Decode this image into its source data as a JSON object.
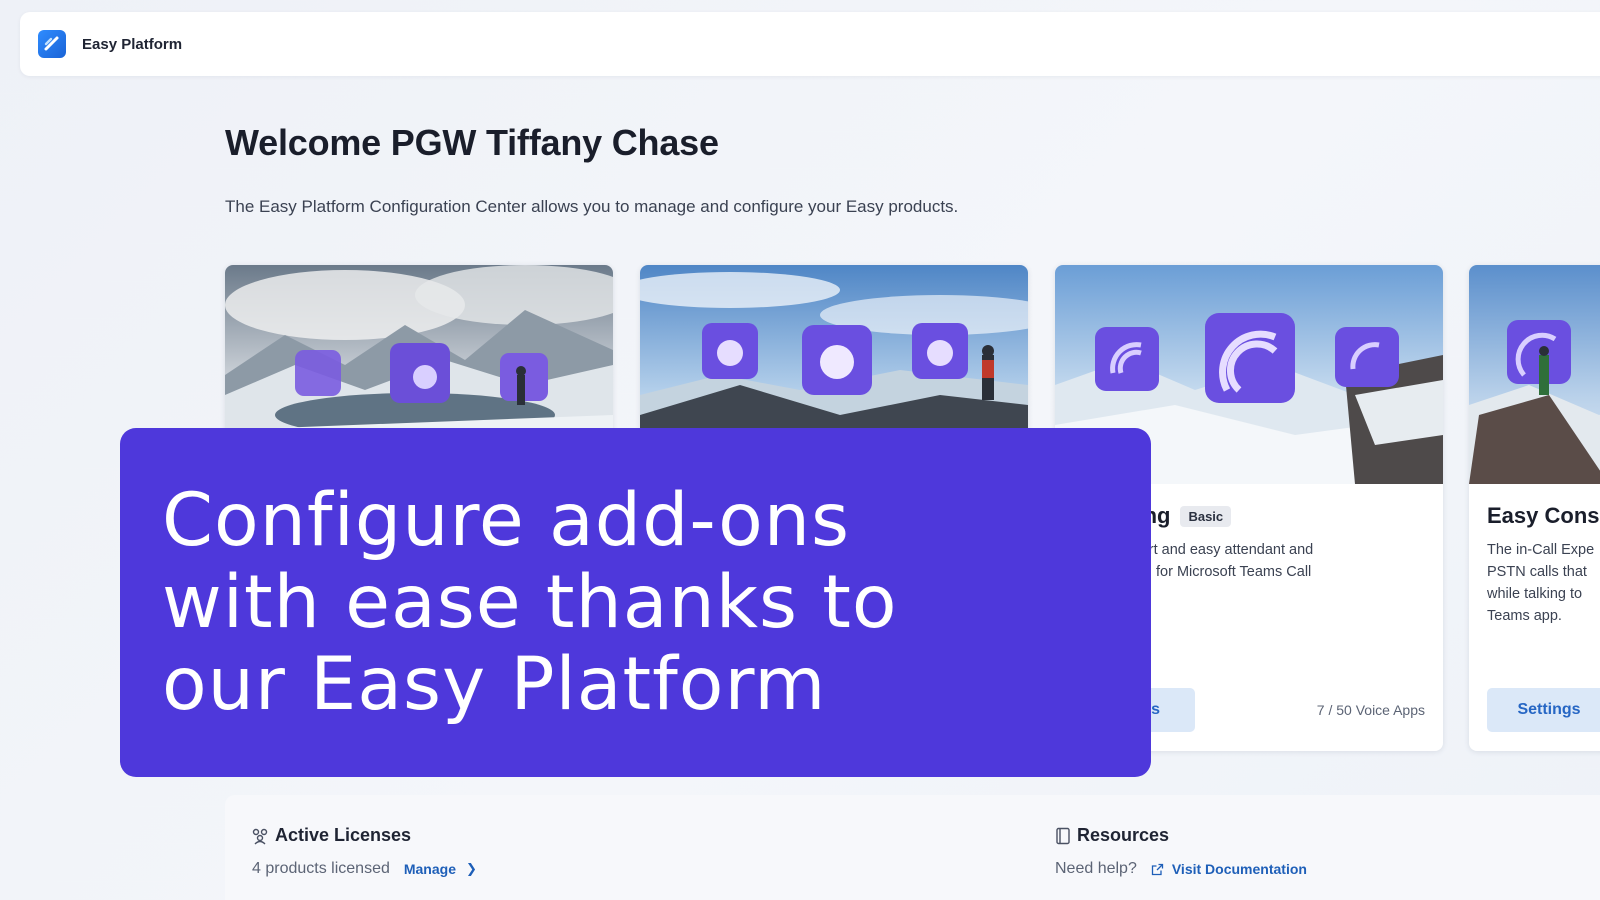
{
  "header": {
    "app_title": "Easy Platform"
  },
  "welcome": {
    "title": "Welcome PGW Tiffany Chase",
    "subtitle": "The Easy Platform Configuration Center allows you to manage and configure your Easy products."
  },
  "cards": [
    {
      "title": "",
      "badge": "",
      "description": "",
      "button": "",
      "usage": ""
    },
    {
      "title": "",
      "badge": "",
      "description": "",
      "button": "",
      "usage": ""
    },
    {
      "title": "alling",
      "badge": "Basic",
      "description_lines": [
        "g – the smart and easy attendant and",
        "nter solution for Microsoft Teams Call",
        "s."
      ],
      "button": "gs",
      "usage": "7 / 50 Voice Apps"
    },
    {
      "title": "Easy Cons",
      "description_lines": [
        "The in-Call Expe",
        "PSTN calls that",
        "while talking to",
        "Teams app."
      ],
      "button": "Settings"
    }
  ],
  "overlay": {
    "lines": [
      "Configure add-ons",
      "with ease thanks to",
      "our Easy Platform"
    ]
  },
  "licenses": {
    "title": "Active Licenses",
    "summary": "4 products licensed",
    "manage_link": "Manage"
  },
  "resources": {
    "title": "Resources",
    "help_text": "Need help?",
    "docs_link": "Visit Documentation"
  },
  "colors": {
    "overlay_bg": "#4e38db",
    "link": "#1e5fb8",
    "button_bg": "#dbe8f8",
    "logo": "#2f8cff"
  }
}
